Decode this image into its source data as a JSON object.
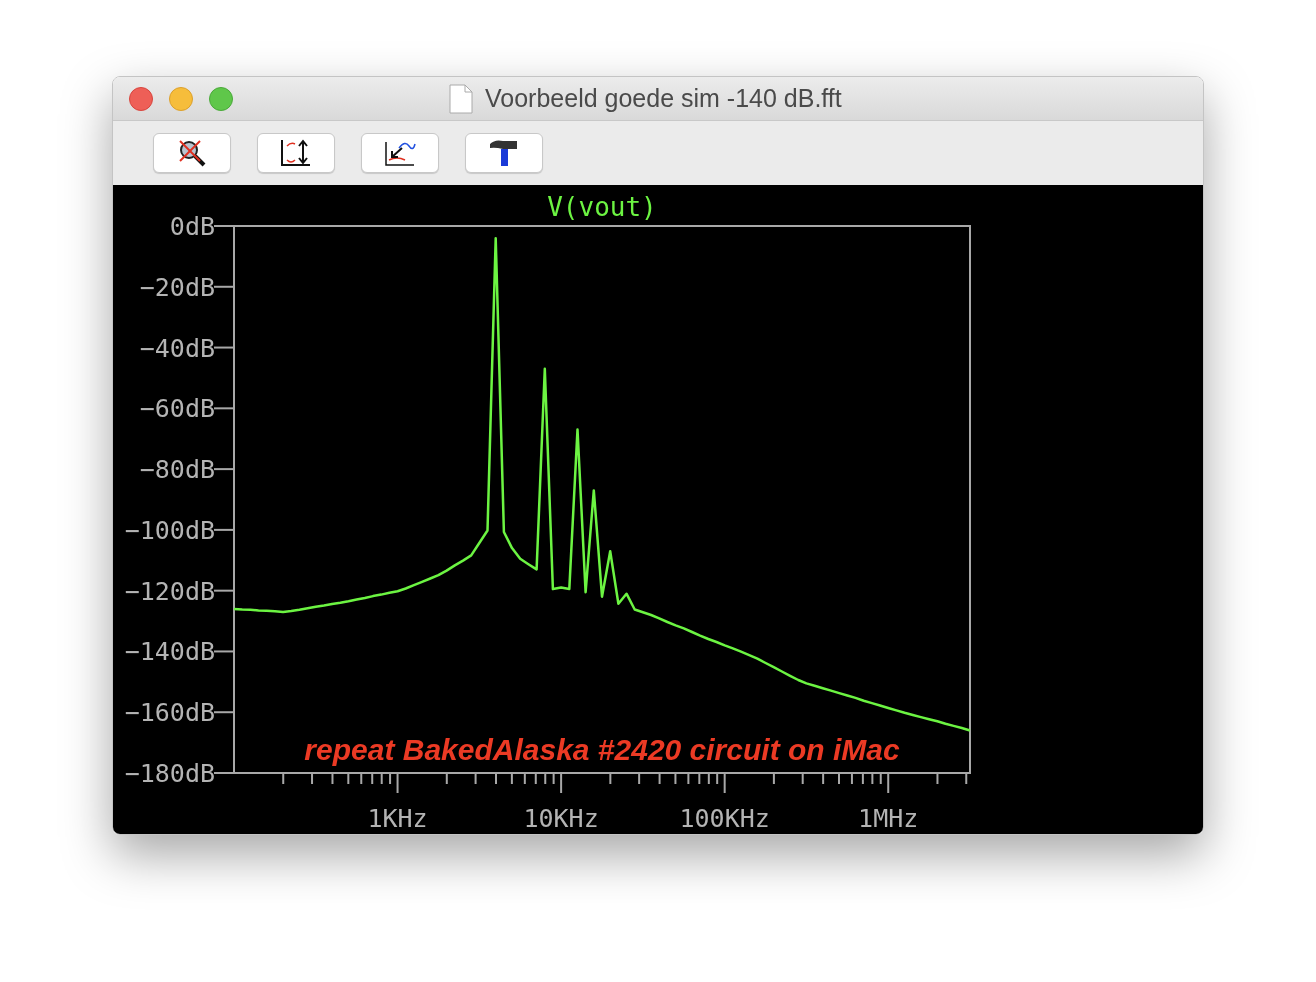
{
  "window": {
    "title": "Voorbeeld goede sim -140 dB.fft"
  },
  "toolbar": {
    "buttons": [
      {
        "kind": "zoom-cancel"
      },
      {
        "kind": "autoscale"
      },
      {
        "kind": "pick-trace"
      },
      {
        "kind": "hammer"
      }
    ]
  },
  "chart_data": {
    "type": "line",
    "title": "V(vout)",
    "categories": [
      null,
      null,
      null,
      null,
      null,
      null,
      null,
      null,
      null,
      null,
      null,
      null,
      null,
      null,
      null,
      null,
      null,
      null,
      null,
      null,
      "1KHz",
      null,
      null,
      null,
      null,
      null,
      null,
      null,
      null,
      null,
      null,
      null,
      null,
      null,
      null,
      null,
      null,
      null,
      null,
      null,
      "10KHz",
      null,
      null,
      null,
      null,
      null,
      null,
      null,
      null,
      null,
      null,
      null,
      null,
      null,
      null,
      null,
      null,
      null,
      null,
      null,
      "100KHz",
      null,
      null,
      null,
      null,
      null,
      null,
      null,
      null,
      null,
      null,
      null,
      null,
      null,
      null,
      null,
      null,
      null,
      null,
      null,
      "1MHz",
      null,
      null,
      null,
      null,
      null,
      null,
      null,
      null,
      null,
      null
    ],
    "series": [
      {
        "color": "#6cf442",
        "values": [
          -126,
          -126.2,
          -126.3,
          -126.5,
          -126.6,
          -126.8,
          -127,
          -126.7,
          -126.3,
          -125.8,
          -125.3,
          -124.9,
          -124.4,
          -124,
          -123.5,
          -122.9,
          -122.4,
          -121.8,
          -121.3,
          -120.7,
          -120.2,
          -119.3,
          -118.2,
          -117.1,
          -116,
          -114.9,
          -113.4,
          -111.7,
          -110.1,
          -108.4,
          -104.3,
          -100.2,
          -4,
          -100.7,
          -106,
          -109.5,
          -111.3,
          -113,
          -47,
          -119.5,
          -119,
          -119.5,
          -67,
          -120.5,
          -87,
          -122,
          -107,
          -124.3,
          -121,
          -126.2,
          -127.1,
          -128,
          -129.1,
          -130.3,
          -131.4,
          -132.4,
          -133.6,
          -134.8,
          -135.9,
          -136.9,
          -138,
          -139,
          -140.1,
          -141.2,
          -142.4,
          -143.8,
          -145.2,
          -146.6,
          -148,
          -149.4,
          -150.5,
          -151.3,
          -152.1,
          -152.9,
          -153.7,
          -154.5,
          -155.3,
          -156.2,
          -157,
          -157.8,
          -158.6,
          -159.4,
          -160.2,
          -160.9,
          -161.6,
          -162.3,
          -163,
          -163.8,
          -164.5,
          -165.2,
          -166
        ]
      }
    ],
    "ylim": [
      -180,
      0
    ],
    "yticks": [
      {
        "value": 0,
        "label": "0dB"
      },
      {
        "value": -20,
        "label": "−20dB"
      },
      {
        "value": -40,
        "label": "−40dB"
      },
      {
        "value": -60,
        "label": "−60dB"
      },
      {
        "value": -80,
        "label": "−80dB"
      },
      {
        "value": -100,
        "label": "−100dB"
      },
      {
        "value": -120,
        "label": "−120dB"
      },
      {
        "value": -140,
        "label": "−140dB"
      },
      {
        "value": -160,
        "label": "−160dB"
      },
      {
        "value": -180,
        "label": "−180dB"
      }
    ],
    "annotations": [
      {
        "text": "repeat BakedAlaska #2420 circuit on iMac"
      }
    ]
  }
}
